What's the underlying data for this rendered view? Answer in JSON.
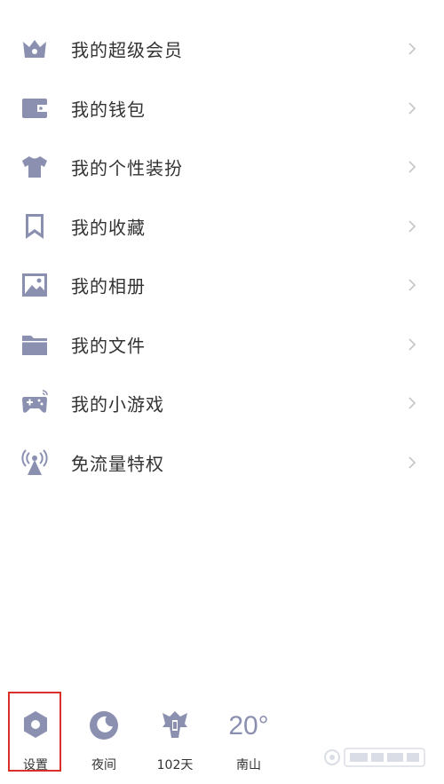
{
  "menu": {
    "items": [
      {
        "label": "我的超级会员",
        "icon": "crown-icon"
      },
      {
        "label": "我的钱包",
        "icon": "wallet-icon"
      },
      {
        "label": "我的个性装扮",
        "icon": "tshirt-icon"
      },
      {
        "label": "我的收藏",
        "icon": "bookmark-icon"
      },
      {
        "label": "我的相册",
        "icon": "photo-icon"
      },
      {
        "label": "我的文件",
        "icon": "folder-icon"
      },
      {
        "label": "我的小游戏",
        "icon": "gamepad-icon"
      },
      {
        "label": "免流量特权",
        "icon": "signal-tower-icon"
      }
    ]
  },
  "bottom_bar": {
    "settings_label": "设置",
    "night_label": "夜间",
    "days_label": "102天",
    "temperature": "20°",
    "location_label": "南山"
  },
  "colors": {
    "icon": "#8b90b0",
    "text": "#333333",
    "chevron": "#c8c8c8",
    "highlight": "#d9302b"
  }
}
